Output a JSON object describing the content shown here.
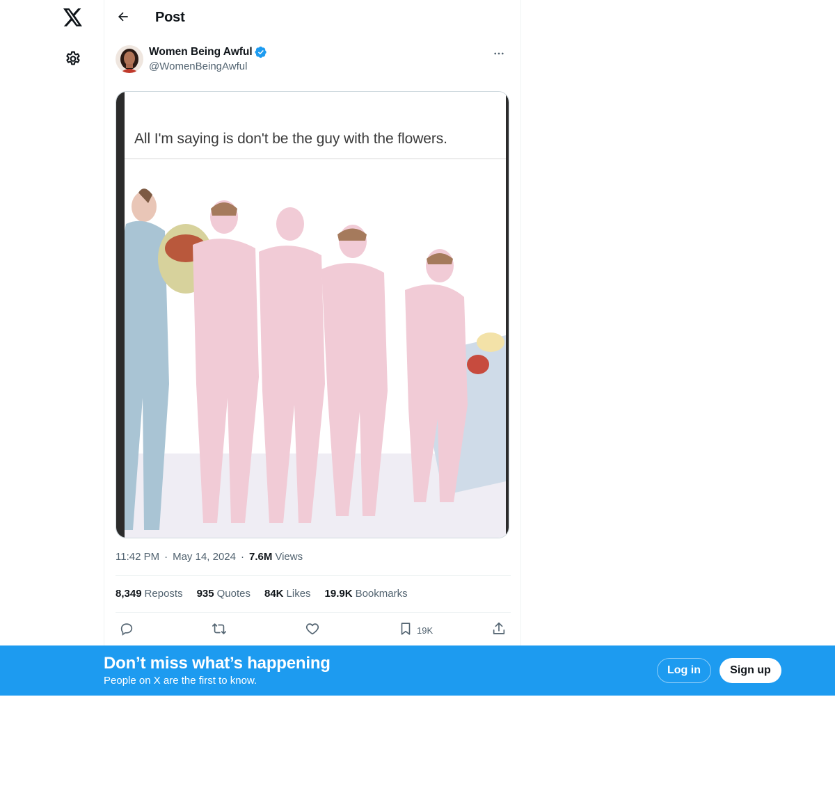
{
  "nav": {
    "logo_icon": "x-logo-icon",
    "settings_icon": "gear-icon"
  },
  "header": {
    "back_icon": "arrow-left-icon",
    "title": "Post"
  },
  "post": {
    "author": {
      "name": "Women Being Awful",
      "handle": "@WomenBeingAwful",
      "verified": true,
      "verified_color": "#1d9bf0"
    },
    "more_icon": "ellipsis-icon",
    "media": {
      "caption": "All I'm saying is don't be the guy with the flowers."
    },
    "meta": {
      "time": "11:42 PM",
      "date": "May 14, 2024",
      "views_count": "7.6M",
      "views_label": "Views"
    },
    "stats": {
      "reposts_count": "8,349",
      "reposts_label": "Reposts",
      "quotes_count": "935",
      "quotes_label": "Quotes",
      "likes_count": "84K",
      "likes_label": "Likes",
      "bookmarks_count": "19.9K",
      "bookmarks_label": "Bookmarks"
    },
    "actions": {
      "reply_icon": "reply-icon",
      "repost_icon": "repost-icon",
      "like_icon": "heart-icon",
      "bookmark_icon": "bookmark-icon",
      "bookmark_count": "19K",
      "share_icon": "share-icon"
    }
  },
  "banner": {
    "title": "Don’t miss what’s happening",
    "subtitle": "People on X are the first to know.",
    "login_label": "Log in",
    "signup_label": "Sign up",
    "background": "#1d9bf0"
  }
}
